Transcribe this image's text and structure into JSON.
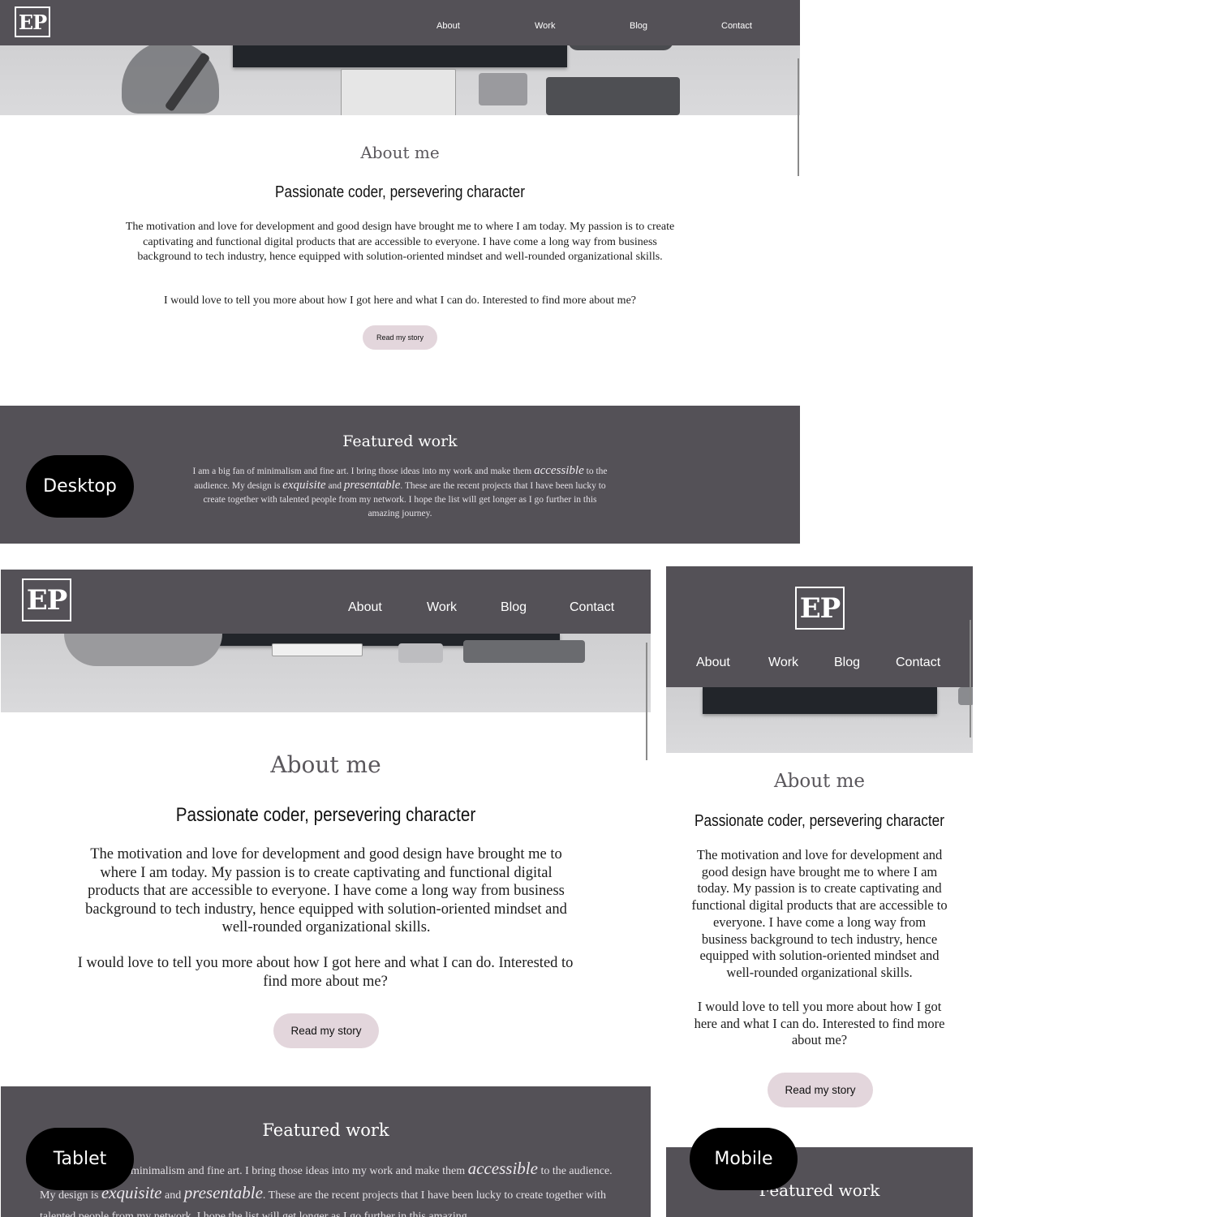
{
  "nav": {
    "logo": "EP",
    "links": [
      "About",
      "Work",
      "Blog",
      "Contact"
    ]
  },
  "about": {
    "heading": "About me",
    "subheading": "Passionate coder, persevering character",
    "paragraph1": "The motivation and love for development and good design have brought me to where I am today. My passion is to create captivating and functional digital products that are accessible to everyone. I have come a long way from business background to tech industry, hence equipped with solution-oriented mindset and well-rounded organizational skills.",
    "paragraph2": "I would love to tell you more about how I got here and what I can do. Interested to find more about me?",
    "button": "Read my story"
  },
  "featured": {
    "heading": "Featured work",
    "text_a": "I am a big fan of minimalism and fine art. I bring those ideas into my work and make them",
    "em1": "accessible",
    "text_b": "to the audience. My design is",
    "em2": "exquisite",
    "text_c": "and",
    "em3": "presentable",
    "text_d": ". These are the recent projects that I have been lucky to create together with talented people from my network. I hope the list will get longer as I go further in this amazing journey.",
    "text_tablet_a": "minimalism and fine art. I bring those ideas into my work and make them",
    "text_tablet_d": ". These are the recent projects that I have been lucky to create together with talented people from my network. I hope the list will get longer as I go further in this amazing"
  },
  "labels": {
    "desktop": "Desktop",
    "tablet": "Tablet",
    "mobile": "Mobile"
  },
  "colors": {
    "nav_bg": "#545157",
    "button_bg": "#e3d6dc",
    "heading": "#5a575c",
    "label_bg": "#000000"
  }
}
